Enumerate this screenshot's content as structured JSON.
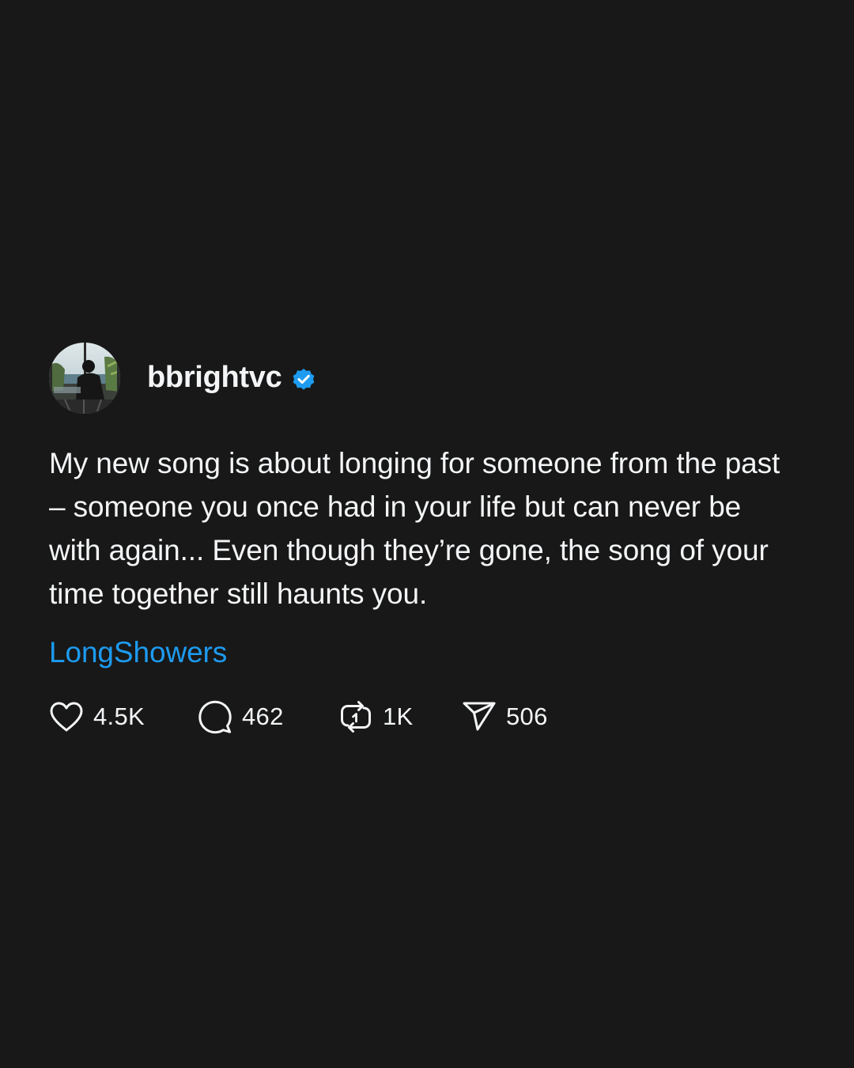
{
  "post": {
    "username": "bbrightvc",
    "verified": true,
    "text": "My new song is about longing for someone from the past – someone you once had in your life but can never be with again... Even though they’re gone, the song of your time together still haunts you.",
    "tag": "LongShowers",
    "stats": {
      "likes": "4.5K",
      "comments": "462",
      "reposts": "1K",
      "shares": "506"
    }
  },
  "icons": {
    "like": "heart-icon",
    "comment": "speech-bubble-icon",
    "repost": "repost-icon",
    "share": "paper-plane-icon",
    "verified": "verified-badge-icon"
  },
  "colors": {
    "background": "#181818",
    "text": "#f3f5f7",
    "link": "#1d9bf0",
    "verified": "#1d9bf0"
  }
}
